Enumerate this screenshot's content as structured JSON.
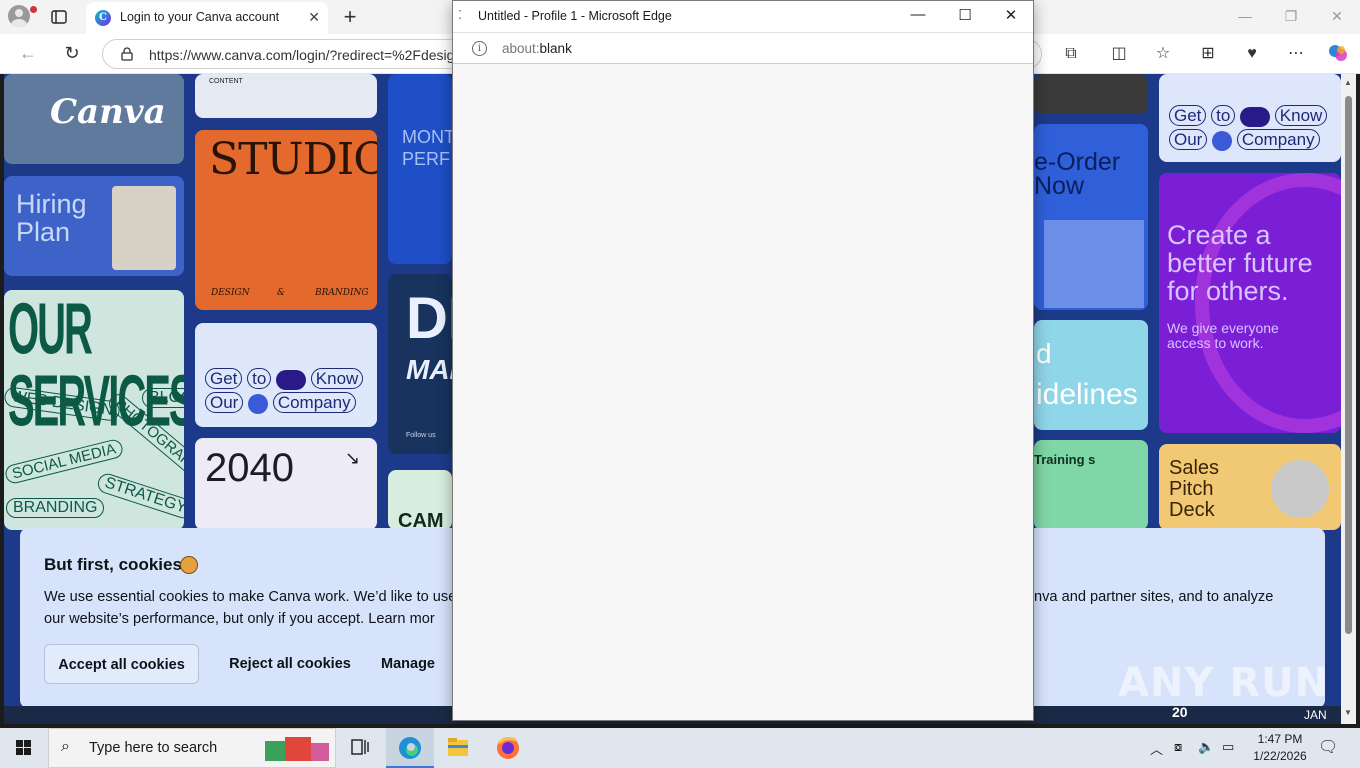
{
  "browser": {
    "tab_title": "Login to your Canva account",
    "address_url": "https://www.canva.com/login/?redirect=%2Fdesig",
    "icons": [
      "profile-icon",
      "tab-actions-icon",
      "back-icon",
      "refresh-icon",
      "lock-icon",
      "extensions-icon",
      "split-screen-icon",
      "favorites-icon",
      "collections-icon",
      "browser-essentials-icon",
      "more-icon",
      "copilot-icon"
    ]
  },
  "page": {
    "brand": "Canva",
    "tiles": {
      "hiring": "Hiring Plan",
      "studio": "STUDIO",
      "studio_design": "DESIGN",
      "studio_amp": "&",
      "studio_branding": "BRANDING",
      "content": "CONTENT",
      "month_perf": "MONTH PERF",
      "services": "OUR SERVICES",
      "services_words": [
        "WEB DESIGN",
        "BLOG",
        "PHOTOGRAPHY",
        "SOCIAL MEDIA",
        "STRATEGY",
        "BRANDING"
      ],
      "get_to_know_1": [
        "Get",
        "to",
        "Know"
      ],
      "get_to_know_2": [
        "Our",
        "Company"
      ],
      "year": "2040",
      "digital_1": "DIG",
      "digital_2": "MAR",
      "follow_us": "Follow us",
      "cam": "CAM",
      "preorder": "e-Order Now",
      "guidelines_1": "d",
      "guidelines_2": "idelines",
      "training": "Training s",
      "right_get_to_know_1": [
        "Get",
        "to",
        "Know"
      ],
      "right_get_to_know_2": [
        "Our",
        "Company"
      ],
      "better_future": "Create a better future for others.",
      "better_future_sub": "We give everyone access to work.",
      "sales_pitch": "Sales Pitch Deck",
      "jan": "JAN",
      "bottom_year": "20"
    },
    "cookie_banner": {
      "heading": "But first, cookies",
      "body_left": "We use essential cookies to make Canva work. We’d like to use",
      "body_left_2": "our website’s performance, but only if you accept. Learn mor",
      "body_right": "nva and partner sites, and to analyze",
      "accept_label": "Accept all cookies",
      "reject_label": "Reject all cookies",
      "manage_label": "Manage"
    },
    "watermark": "ANY RUN"
  },
  "popup": {
    "title": "Untitled - Profile 1 - Microsoft Edge",
    "url_prefix": "about:",
    "url_rest": "blank"
  },
  "taskbar": {
    "search_placeholder": "Type here to search",
    "time": "1:47 PM",
    "date": "1/22/2026",
    "apps": [
      "task-view-icon",
      "edge-icon",
      "file-explorer-icon",
      "firefox-icon"
    ]
  },
  "colors": {
    "canva_bg": "#1d3a8a",
    "cookie_bg": "#d7e3fb",
    "studio_orange": "#e36a2c",
    "purple_tile": "#7a1fd6"
  }
}
